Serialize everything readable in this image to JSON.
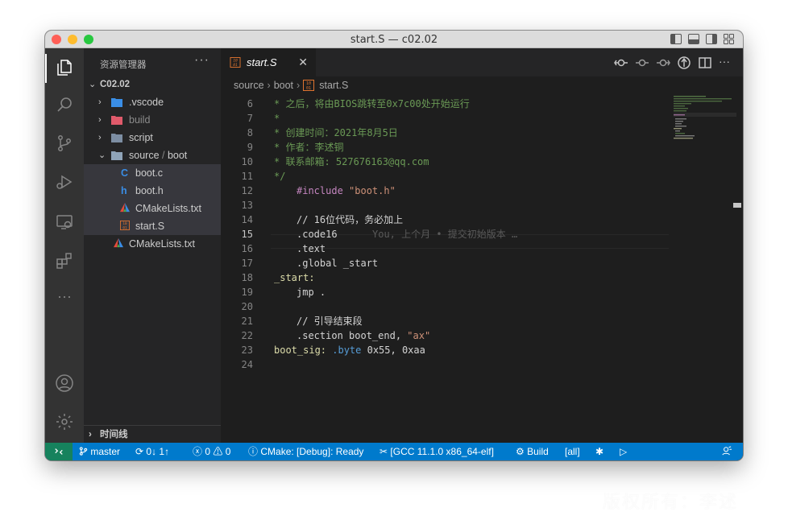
{
  "window": {
    "title": "start.S — c02.02"
  },
  "sidebar": {
    "header": "资源管理器",
    "more": "···",
    "root": "C02.02",
    "items": [
      {
        "label": ".vscode"
      },
      {
        "label": "build"
      },
      {
        "label": "script"
      },
      {
        "label": "source",
        "label2": "boot"
      },
      {
        "label": "boot.c"
      },
      {
        "label": "boot.h"
      },
      {
        "label": "CMakeLists.txt"
      },
      {
        "label": "start.S"
      },
      {
        "label": "CMakeLists.txt"
      }
    ],
    "timeline": "时间线"
  },
  "tab": {
    "label": "start.S",
    "close": "✕"
  },
  "breadcrumb": {
    "seg1": "source",
    "seg2": "boot",
    "seg3": "start.S"
  },
  "editor": {
    "lines": [
      {
        "n": "6",
        "t": "* 之后，将由BIOS跳转至0x7c00处开始运行"
      },
      {
        "n": "7",
        "t": "*"
      },
      {
        "n": "8",
        "t": "* 创建时间：2021年8月5日"
      },
      {
        "n": "9",
        "t": "* 作者：李述铜"
      },
      {
        "n": "10",
        "t": "* 联系邮箱: 527676163@qq.com"
      },
      {
        "n": "11",
        "t": "*/"
      },
      {
        "n": "12",
        "a": "#include ",
        "b": "\"boot.h\""
      },
      {
        "n": "13",
        "t": ""
      },
      {
        "n": "14",
        "t": "// 16位代码，务必加上"
      },
      {
        "n": "15",
        "t": ".code16",
        "blame": "You, 上个月 • 提交初始版本 …"
      },
      {
        "n": "16",
        "t": ".text"
      },
      {
        "n": "17",
        "t": ".global _start"
      },
      {
        "n": "18",
        "t": "_start:"
      },
      {
        "n": "19",
        "t": "jmp ."
      },
      {
        "n": "20",
        "t": ""
      },
      {
        "n": "21",
        "t": "// 引导结束段"
      },
      {
        "n": "22",
        "a": ".section boot_end, ",
        "b": "\"ax\""
      },
      {
        "n": "23",
        "a": "boot_sig: ",
        "b": ".byte",
        "c": " 0x55, 0xaa"
      },
      {
        "n": "24",
        "t": ""
      }
    ]
  },
  "statusbar": {
    "branch": "master",
    "sync": "0↓ 1↑",
    "errors": "0",
    "warnings": "0",
    "cmake": "CMake: [Debug]: Ready",
    "kit": "[GCC 11.1.0 x86_64-elf]",
    "build": "Build",
    "target": "[all]"
  },
  "watermark": "版权所有：李述"
}
